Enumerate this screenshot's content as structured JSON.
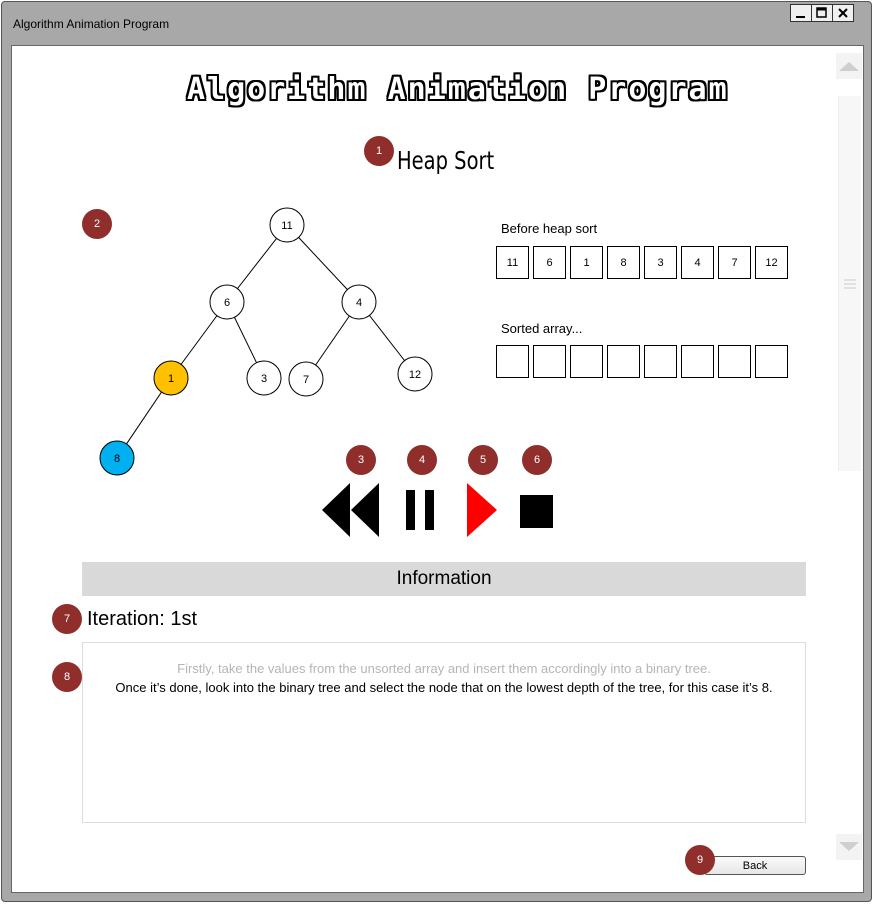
{
  "window": {
    "title": "Algorithm Animation Program"
  },
  "banner": "Algorithm Animation Program",
  "heading": "Heap Sort",
  "markers": [
    "1",
    "2",
    "3",
    "4",
    "5",
    "6",
    "7",
    "8",
    "9"
  ],
  "tree": {
    "nodes": [
      {
        "id": "n11",
        "label": "11",
        "state": "normal"
      },
      {
        "id": "n6",
        "label": "6",
        "state": "normal"
      },
      {
        "id": "n4",
        "label": "4",
        "state": "normal"
      },
      {
        "id": "n1",
        "label": "1",
        "state": "current"
      },
      {
        "id": "n3",
        "label": "3",
        "state": "normal"
      },
      {
        "id": "n7",
        "label": "7",
        "state": "normal"
      },
      {
        "id": "n12",
        "label": "12",
        "state": "normal"
      },
      {
        "id": "n8",
        "label": "8",
        "state": "selected"
      }
    ],
    "edges": [
      [
        "n11",
        "n6"
      ],
      [
        "n11",
        "n4"
      ],
      [
        "n6",
        "n1"
      ],
      [
        "n6",
        "n3"
      ],
      [
        "n4",
        "n7"
      ],
      [
        "n4",
        "n12"
      ],
      [
        "n1",
        "n8"
      ]
    ],
    "colors": {
      "current": "#ffc000",
      "selected": "#00b0f0",
      "normal": "#ffffff"
    }
  },
  "before_label": "Before heap sort",
  "before_array": [
    "11",
    "6",
    "1",
    "8",
    "3",
    "4",
    "7",
    "12"
  ],
  "sorted_label": "Sorted array...",
  "sorted_array": [
    "",
    "",
    "",
    "",
    "",
    "",
    "",
    ""
  ],
  "controls": {
    "rewind_icon": "rewind-icon",
    "pause_icon": "pause-icon",
    "play_icon": "play-icon",
    "stop_icon": "stop-icon",
    "play_color": "#ff0000"
  },
  "info_title": "Information",
  "iteration": "Iteration: 1st",
  "description": {
    "line1": "Firstly, take the values from the unsorted array and insert them accordingly into a binary tree.",
    "line2": "Once it’s done, look into the binary tree and select the node that on the lowest depth of the tree, for this case it’s 8."
  },
  "back_label": "Back"
}
